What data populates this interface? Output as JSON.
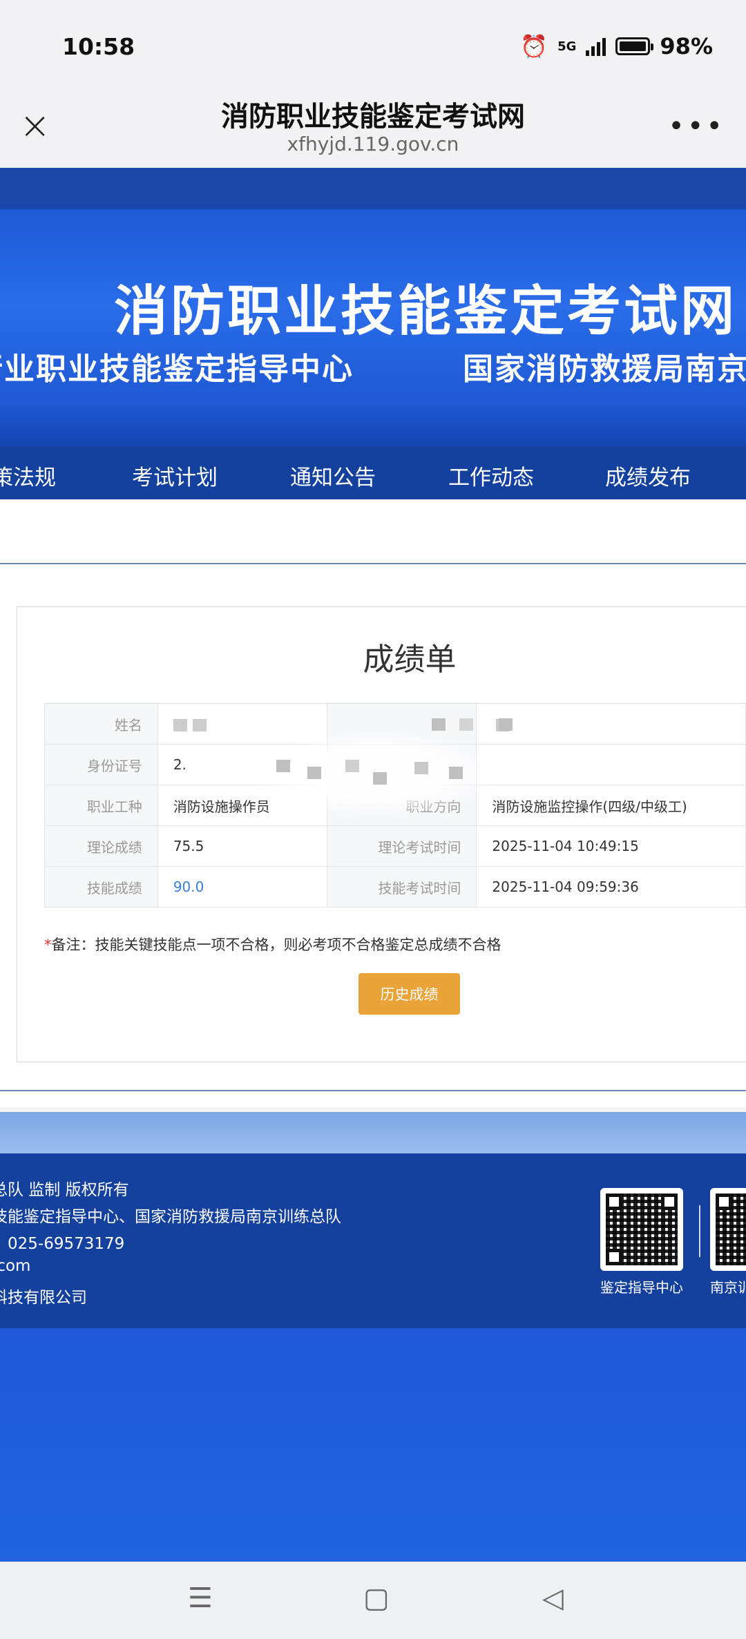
{
  "status": {
    "time": "10:58",
    "network": "5G",
    "battery": "98%",
    "battery_level": 0.98
  },
  "titlebar": {
    "title": "消防职业技能鉴定考试网",
    "url": "xfhyjd.119.gov.cn",
    "close_icon": "×",
    "more_icon": "•••"
  },
  "banner": {
    "title": "消防职业技能鉴定考试网",
    "sub_left": "行业职业技能鉴定指导中心",
    "sub_right": "国家消防救援局南京"
  },
  "nav": [
    "策法规",
    "考试计划",
    "通知公告",
    "工作动态",
    "成绩发布"
  ],
  "report": {
    "title": "成绩单",
    "rows": [
      {
        "l1": "姓名",
        "v1": "",
        "l2": "",
        "v2": ""
      },
      {
        "l1": "身份证号",
        "v1": "2.",
        "l2": "",
        "v2": ""
      },
      {
        "l1": "职业工种",
        "v1": "消防设施操作员",
        "l2": "职业方向",
        "v2": "消防设施监控操作(四级/中级工)"
      },
      {
        "l1": "理论成绩",
        "v1": "75.5",
        "l2": "理论考试时间",
        "v2": "2025-11-04 10:49:15"
      },
      {
        "l1": "技能成绩",
        "v1": "90.0",
        "l2": "技能考试时间",
        "v2": "2025-11-04 09:59:36"
      }
    ],
    "note_star": "*",
    "note": "备注：技能关键技能点一项不合格，则必考项不合格鉴定总成绩不合格",
    "history_button": "历史成绩"
  },
  "footer": {
    "lines": [
      "总队 监制 版权所有",
      "技能鉴定指导中心、国家消防救援局南京训练总队",
      "、025-69573179",
      ".com",
      "科技有限公司"
    ],
    "qr1_label": "鉴定指导中心",
    "qr2_label": "南京训"
  },
  "android_nav": {
    "menu_icon": "☰",
    "home_icon": "▢",
    "back_icon": "◁"
  }
}
